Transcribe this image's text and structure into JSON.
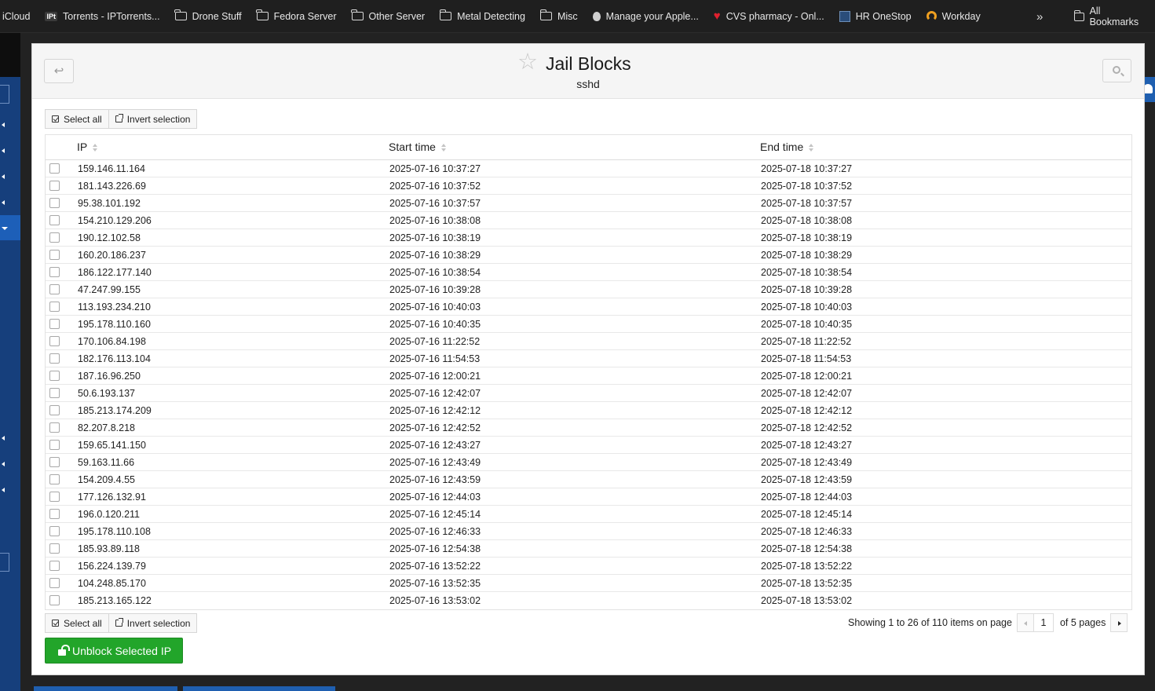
{
  "bookmarks": {
    "items": [
      {
        "label": "iCloud",
        "icon": "none"
      },
      {
        "label": "Torrents - IPTorrents...",
        "icon": "iptorrents-icon",
        "icon_text": "IPt"
      },
      {
        "label": "Drone Stuff",
        "icon": "folder-icon"
      },
      {
        "label": "Fedora Server",
        "icon": "folder-icon"
      },
      {
        "label": "Other Server",
        "icon": "folder-icon"
      },
      {
        "label": "Metal Detecting",
        "icon": "folder-icon"
      },
      {
        "label": "Misc",
        "icon": "folder-icon"
      },
      {
        "label": "Manage your Apple...",
        "icon": "apple-icon"
      },
      {
        "label": "CVS pharmacy - Onl...",
        "icon": "heart-icon"
      },
      {
        "label": "HR OneStop",
        "icon": "hr-icon"
      },
      {
        "label": "Workday",
        "icon": "workday-icon"
      }
    ],
    "more": "»",
    "all_bookmarks": "All Bookmarks"
  },
  "header": {
    "title": "Jail Blocks",
    "subtitle": "sshd",
    "back_symbol": "↩",
    "star_symbol": "☆"
  },
  "toolbar": {
    "select_all": "Select all",
    "invert_selection": "Invert selection"
  },
  "table": {
    "columns": [
      "IP",
      "Start time",
      "End time"
    ],
    "rows": [
      [
        "159.146.11.164",
        "2025-07-16 10:37:27",
        "2025-07-18 10:37:27"
      ],
      [
        "181.143.226.69",
        "2025-07-16 10:37:52",
        "2025-07-18 10:37:52"
      ],
      [
        "95.38.101.192",
        "2025-07-16 10:37:57",
        "2025-07-18 10:37:57"
      ],
      [
        "154.210.129.206",
        "2025-07-16 10:38:08",
        "2025-07-18 10:38:08"
      ],
      [
        "190.12.102.58",
        "2025-07-16 10:38:19",
        "2025-07-18 10:38:19"
      ],
      [
        "160.20.186.237",
        "2025-07-16 10:38:29",
        "2025-07-18 10:38:29"
      ],
      [
        "186.122.177.140",
        "2025-07-16 10:38:54",
        "2025-07-18 10:38:54"
      ],
      [
        "47.247.99.155",
        "2025-07-16 10:39:28",
        "2025-07-18 10:39:28"
      ],
      [
        "113.193.234.210",
        "2025-07-16 10:40:03",
        "2025-07-18 10:40:03"
      ],
      [
        "195.178.110.160",
        "2025-07-16 10:40:35",
        "2025-07-18 10:40:35"
      ],
      [
        "170.106.84.198",
        "2025-07-16 11:22:52",
        "2025-07-18 11:22:52"
      ],
      [
        "182.176.113.104",
        "2025-07-16 11:54:53",
        "2025-07-18 11:54:53"
      ],
      [
        "187.16.96.250",
        "2025-07-16 12:00:21",
        "2025-07-18 12:00:21"
      ],
      [
        "50.6.193.137",
        "2025-07-16 12:42:07",
        "2025-07-18 12:42:07"
      ],
      [
        "185.213.174.209",
        "2025-07-16 12:42:12",
        "2025-07-18 12:42:12"
      ],
      [
        "82.207.8.218",
        "2025-07-16 12:42:52",
        "2025-07-18 12:42:52"
      ],
      [
        "159.65.141.150",
        "2025-07-16 12:43:27",
        "2025-07-18 12:43:27"
      ],
      [
        "59.163.11.66",
        "2025-07-16 12:43:49",
        "2025-07-18 12:43:49"
      ],
      [
        "154.209.4.55",
        "2025-07-16 12:43:59",
        "2025-07-18 12:43:59"
      ],
      [
        "177.126.132.91",
        "2025-07-16 12:44:03",
        "2025-07-18 12:44:03"
      ],
      [
        "196.0.120.211",
        "2025-07-16 12:45:14",
        "2025-07-18 12:45:14"
      ],
      [
        "195.178.110.108",
        "2025-07-16 12:46:33",
        "2025-07-18 12:46:33"
      ],
      [
        "185.93.89.118",
        "2025-07-16 12:54:38",
        "2025-07-18 12:54:38"
      ],
      [
        "156.224.139.79",
        "2025-07-16 13:52:22",
        "2025-07-18 13:52:22"
      ],
      [
        "104.248.85.170",
        "2025-07-16 13:52:35",
        "2025-07-18 13:52:35"
      ],
      [
        "185.213.165.122",
        "2025-07-16 13:53:02",
        "2025-07-18 13:53:02"
      ]
    ]
  },
  "pagination": {
    "summary": "Showing 1 to 26 of 110 items on page",
    "current_page": "1",
    "of_pages": "of 5 pages"
  },
  "actions": {
    "unblock_label": "Unblock Selected IP"
  },
  "colors": {
    "sidebar": "#163f7c",
    "accent_blue": "#1f5fb0",
    "unblock_green": "#22a52a",
    "bookmarks_bg": "#1f1f1f"
  }
}
